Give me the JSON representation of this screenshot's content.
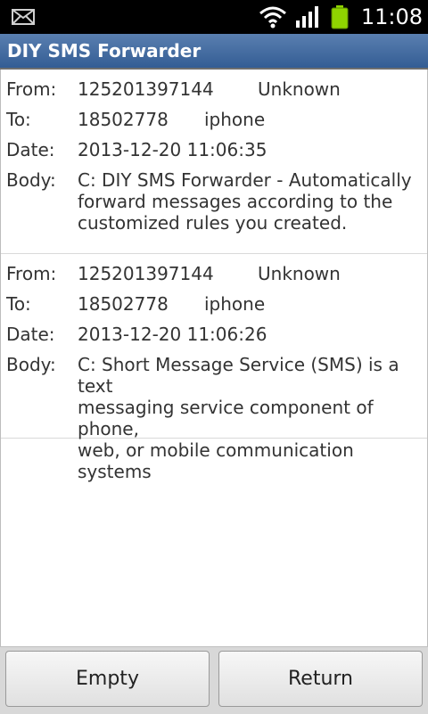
{
  "status_bar": {
    "time": "11:08",
    "icons": [
      "mail-icon",
      "wifi-icon",
      "signal-icon",
      "battery-icon"
    ]
  },
  "app": {
    "title": "DIY SMS Forwarder"
  },
  "labels": {
    "from": "From:",
    "to": "To:",
    "date": "Date:",
    "body": "Body:"
  },
  "messages": [
    {
      "from_number": "125201397144",
      "from_name": "Unknown",
      "to_number": "18502778",
      "to_name": "iphone",
      "date": "2013-12-20 11:06:35",
      "body_lines": [
        "C: DIY SMS Forwarder - Automatically",
        "forward messages according to the",
        "customized rules you created."
      ]
    },
    {
      "from_number": "125201397144",
      "from_name": "Unknown",
      "to_number": "18502778",
      "to_name": "iphone",
      "date": "2013-12-20 11:06:26",
      "body_lines": [
        "C: Short Message Service (SMS) is a text",
        "messaging service component of phone,",
        "web, or mobile communication systems"
      ]
    }
  ],
  "buttons": {
    "empty": "Empty",
    "return": "Return"
  },
  "colors": {
    "title_bar": "#335d94",
    "status_bar": "#000000",
    "battery": "#8fd400"
  }
}
